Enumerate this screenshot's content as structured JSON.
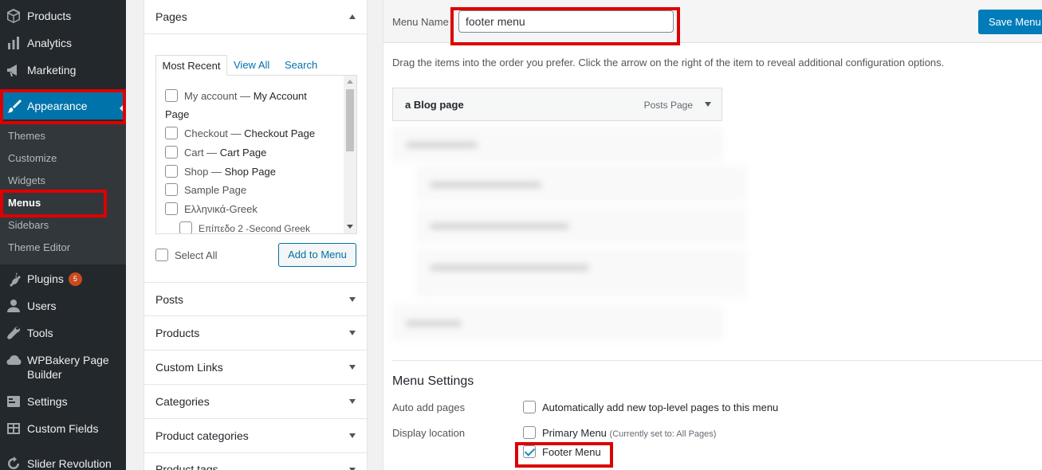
{
  "sidebar": {
    "items": [
      {
        "label": "Products",
        "icon": "cube-icon"
      },
      {
        "label": "Analytics",
        "icon": "bar-chart-icon"
      },
      {
        "label": "Marketing",
        "icon": "megaphone-icon"
      },
      {
        "label": "Appearance",
        "icon": "paintbrush-icon"
      },
      {
        "label": "Plugins",
        "icon": "plugin-icon",
        "badge": "5"
      },
      {
        "label": "Users",
        "icon": "users-icon"
      },
      {
        "label": "Tools",
        "icon": "wrench-icon"
      },
      {
        "label": "WPBakery Page Builder",
        "icon": "cloud-icon"
      },
      {
        "label": "Settings",
        "icon": "settings-icon"
      },
      {
        "label": "Custom Fields",
        "icon": "table-icon"
      },
      {
        "label": "Slider Revolution",
        "icon": "refresh-icon"
      }
    ],
    "submenu": [
      "Themes",
      "Customize",
      "Widgets",
      "Menus",
      "Sidebars",
      "Theme Editor"
    ],
    "current_submenu": "Menus"
  },
  "pages_panel": {
    "title": "Pages",
    "tabs": [
      "Most Recent",
      "View All",
      "Search"
    ],
    "items": [
      {
        "pre": "My account — ",
        "bold": "My Account"
      },
      {
        "pre": "Page",
        "bold": ""
      },
      {
        "pre": "Checkout — ",
        "bold": "Checkout Page"
      },
      {
        "pre": "Cart — ",
        "bold": "Cart Page"
      },
      {
        "pre": "Shop — ",
        "bold": "Shop Page"
      },
      {
        "pre": "Sample Page",
        "bold": ""
      },
      {
        "pre": "Ελληνικά-Greek",
        "bold": ""
      },
      {
        "pre": "Επίπεδο 2 -Second Greek",
        "bold": ""
      }
    ],
    "select_all": "Select All",
    "add_button": "Add to Menu"
  },
  "accordion": [
    "Posts",
    "Products",
    "Custom Links",
    "Categories",
    "Product categories",
    "Product tags"
  ],
  "menu_editor": {
    "name_label": "Menu Name",
    "name_value": "footer menu",
    "save_button": "Save Menu",
    "instructions": "Drag the items into the order you prefer. Click the arrow on the right of the item to reveal additional configuration options.",
    "first_item": {
      "title": "a Blog page",
      "type": "Posts Page"
    }
  },
  "menu_settings": {
    "title": "Menu Settings",
    "auto_add_label": "Auto add pages",
    "auto_add_option": "Automatically add new top-level pages to this menu",
    "display_location_label": "Display location",
    "locations": [
      {
        "label": "Primary Menu",
        "note": "(Currently set to: All Pages)",
        "checked": false
      },
      {
        "label": "Footer Menu",
        "note": "",
        "checked": true
      }
    ]
  },
  "colors": {
    "accent": "#0073aa",
    "highlight": "#dd0000",
    "sidebar_bg": "#23282d"
  }
}
